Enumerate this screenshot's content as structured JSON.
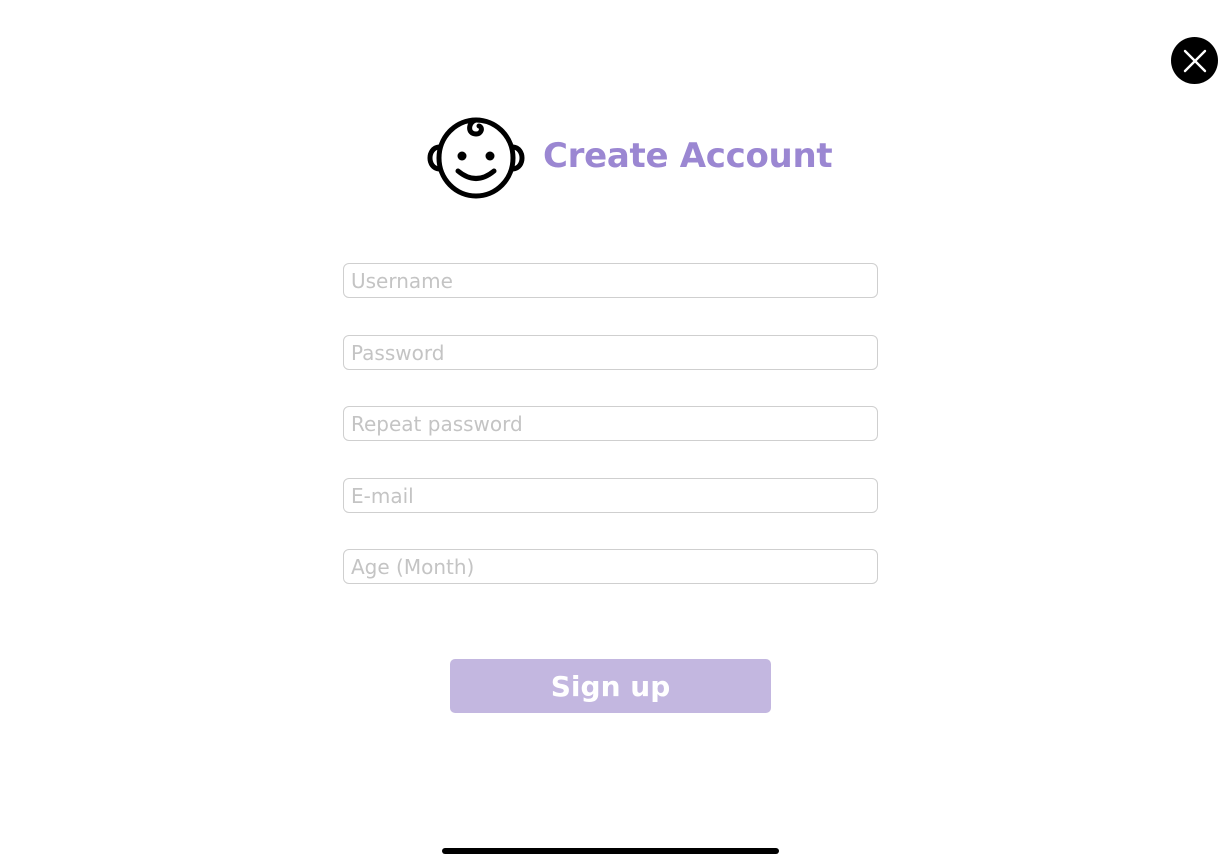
{
  "header": {
    "title": "Create Account",
    "icon": "baby-face-icon"
  },
  "close_button": {
    "icon": "close-icon"
  },
  "form": {
    "fields": [
      {
        "name": "username",
        "value": "",
        "placeholder": "Username"
      },
      {
        "name": "password",
        "value": "",
        "placeholder": "Password"
      },
      {
        "name": "repeat_password",
        "value": "",
        "placeholder": "Repeat password"
      },
      {
        "name": "email",
        "value": "",
        "placeholder": "E-mail"
      },
      {
        "name": "age_month",
        "value": "",
        "placeholder": "Age (Month)"
      }
    ],
    "submit_label": "Sign up"
  },
  "colors": {
    "accent": "#9b87d2",
    "button": "#c3b7e0",
    "text_placeholder": "#c4c4c4",
    "border": "#cfcfcf"
  }
}
